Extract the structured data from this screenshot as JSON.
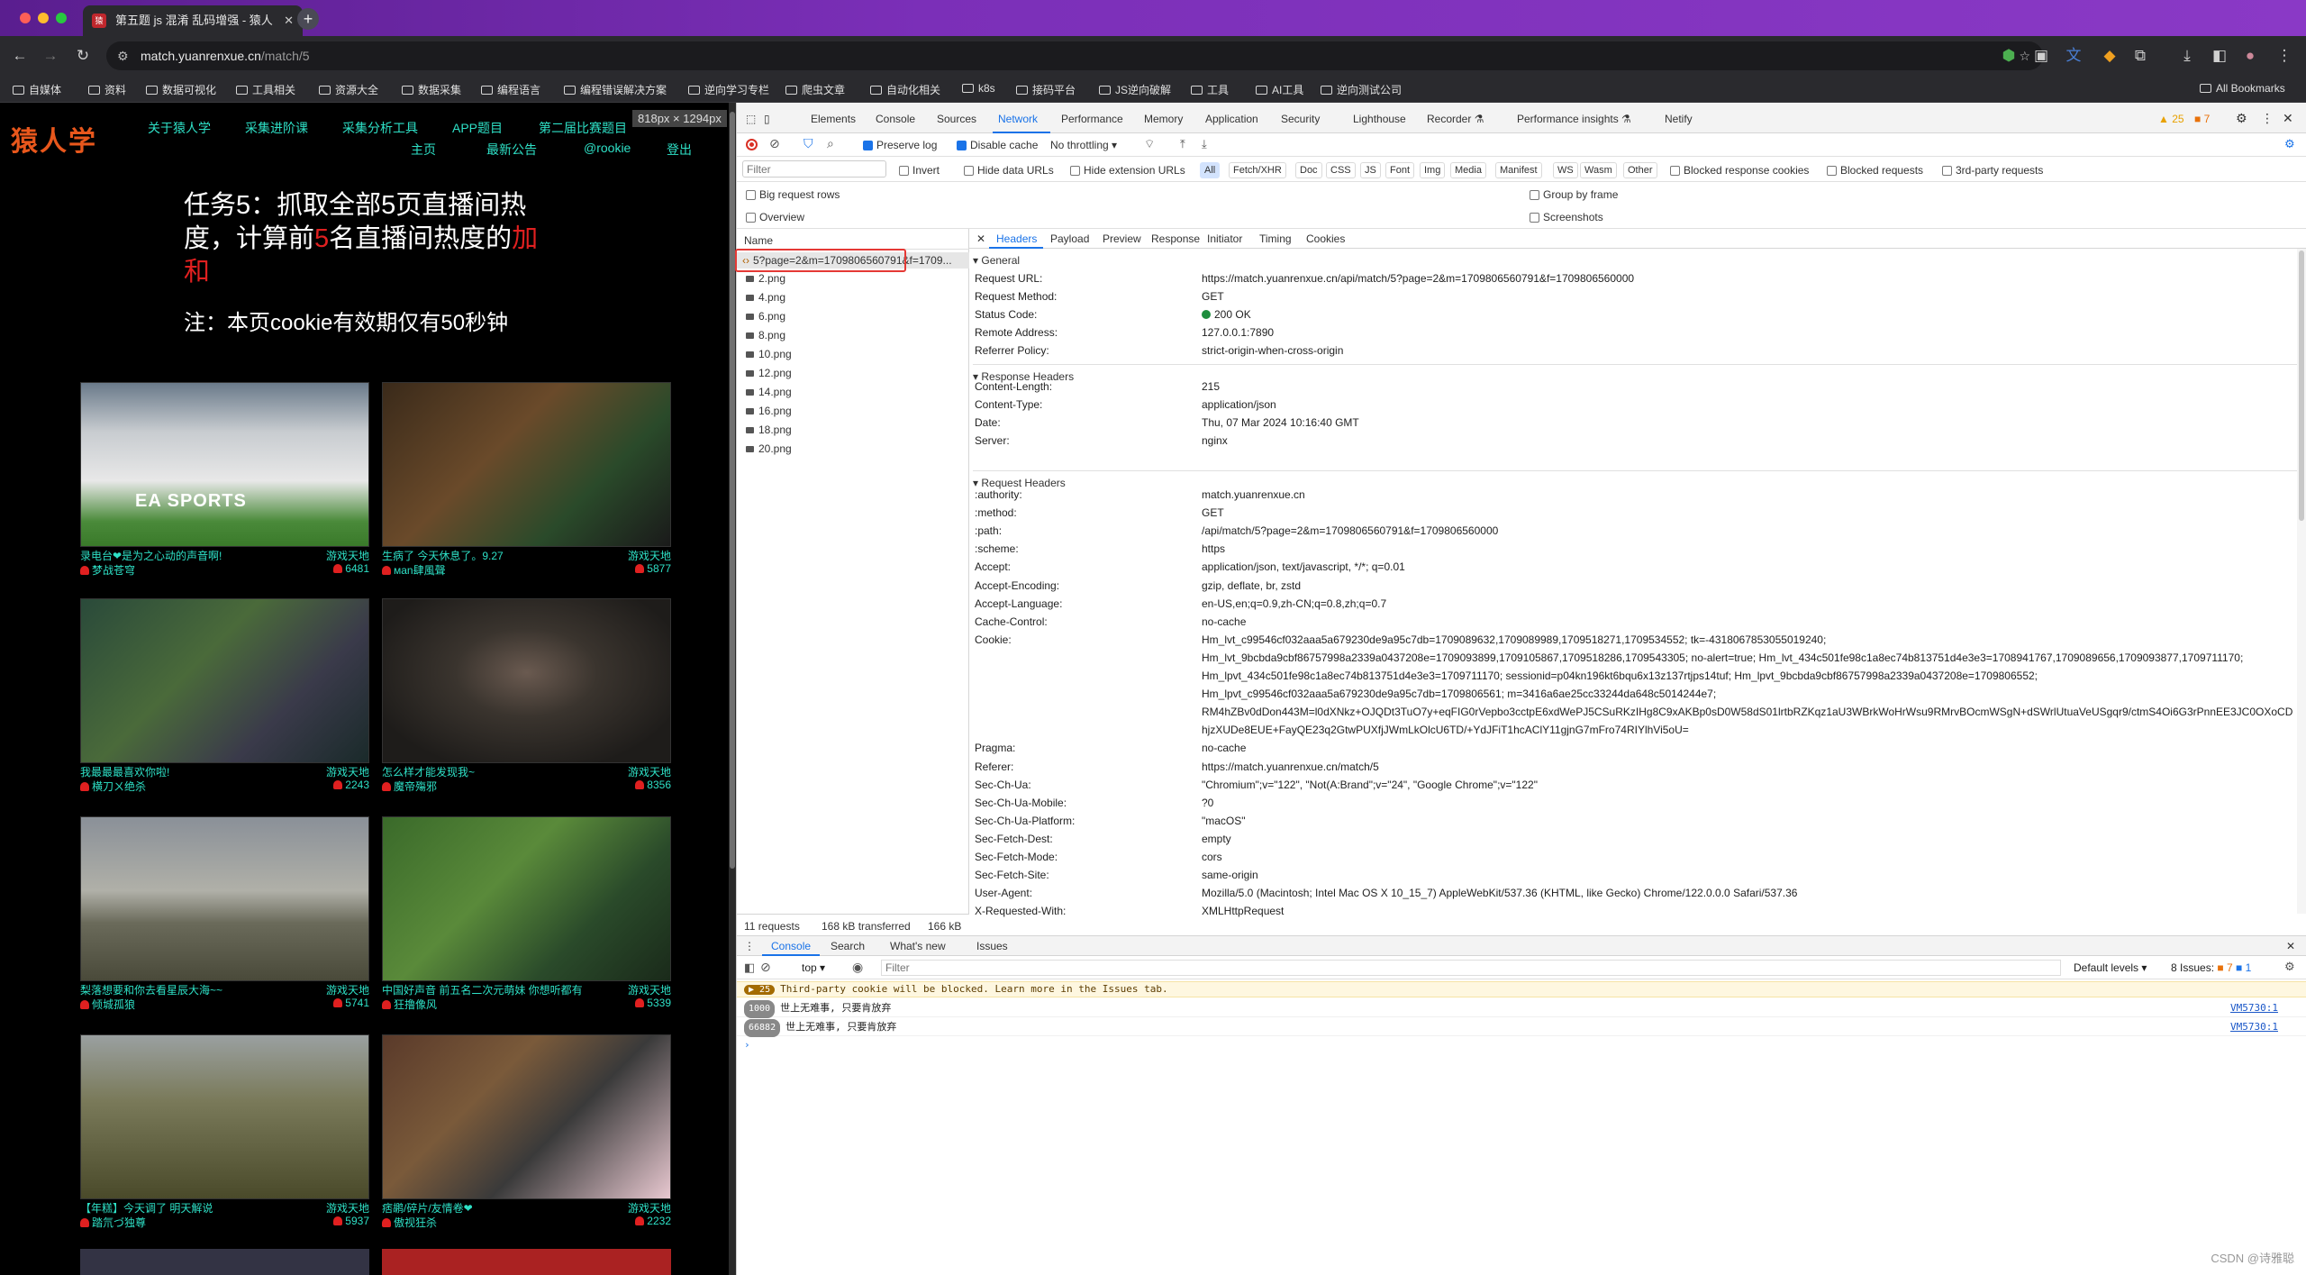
{
  "browser": {
    "tab_title": "第五题 js 混淆 乱码增强 - 猿人",
    "tab_favicon": "猿",
    "url_host": "match.yuanrenxue.cn",
    "url_path": "/match/5",
    "bookmarks": [
      "自媒体",
      "资料",
      "数据可视化",
      "工具相关",
      "资源大全",
      "数据采集",
      "编程语言",
      "编程错误解决方案",
      "逆向学习专栏",
      "爬虫文章",
      "自动化相关",
      "k8s",
      "接码平台",
      "JS逆向破解",
      "工具",
      "AI工具",
      "逆向测试公司"
    ],
    "all_bookmarks": "All Bookmarks"
  },
  "site": {
    "logo": "猿人学",
    "nav": [
      "关于猿人学",
      "采集进阶课",
      "采集分析工具",
      "APP题目",
      "第二届比赛题目",
      "主页",
      "最新公告",
      "@rookie",
      "登出"
    ],
    "dim_badge": "818px × 1294px",
    "task_prefix": "任务5：抓取全部5页直播间热度，计算前",
    "task_num": "5",
    "task_mid": "名直播间热度的",
    "task_red": "加和",
    "note": "注：本页cookie有效期仅有50秒钟",
    "cards": [
      {
        "title": "录电台❤是为之心动的声音啊!",
        "cat": "游戏天地",
        "author": "梦战苍穹",
        "hot": "6481"
      },
      {
        "title": "生病了 今天休息了。9.27",
        "cat": "游戏天地",
        "author": "мan肆風聲",
        "hot": "5877"
      },
      {
        "title": "我最最最喜欢你啦!",
        "cat": "游戏天地",
        "author": "横刀ㄨ绝杀",
        "hot": "2243"
      },
      {
        "title": "怎么样才能发现我~",
        "cat": "游戏天地",
        "author": "魔帝殤邪",
        "hot": "8356"
      },
      {
        "title": "梨落想要和你去看星辰大海~~",
        "cat": "游戏天地",
        "author": "倾城孤狼",
        "hot": "5741"
      },
      {
        "title": "中国好声音 前五名二次元萌妹 你想听都有",
        "cat": "游戏天地",
        "author": "狂撸像风",
        "hot": "5339"
      },
      {
        "title": "【年糕】今天调了 明天解说",
        "cat": "游戏天地",
        "author": "踏氘づ独尊",
        "hot": "5937"
      },
      {
        "title": "痞鹕/碎片/友情卷❤",
        "cat": "游戏天地",
        "author": "傲视狂杀",
        "hot": "2232"
      }
    ]
  },
  "devtools": {
    "tabs": [
      "Elements",
      "Console",
      "Sources",
      "Network",
      "Performance",
      "Memory",
      "Application",
      "Security",
      "Lighthouse",
      "Recorder ⚗",
      "Performance insights ⚗",
      "Netify"
    ],
    "warn_count": "25",
    "err_count": "7",
    "toolbar": {
      "preserve_log": "Preserve log",
      "disable_cache": "Disable cache",
      "throttling": "No throttling"
    },
    "filter_placeholder": "Filter",
    "filter_opts": [
      "Invert",
      "Hide data URLs",
      "Hide extension URLs"
    ],
    "chips": [
      "All",
      "Fetch/XHR",
      "Doc",
      "CSS",
      "JS",
      "Font",
      "Img",
      "Media",
      "Manifest",
      "WS",
      "Wasm",
      "Other"
    ],
    "extra_opts": [
      "Blocked response cookies",
      "Blocked requests",
      "3rd-party requests"
    ],
    "opts": [
      "Big request rows",
      "Overview",
      "Group by frame",
      "Screenshots"
    ],
    "name_header": "Name",
    "requests": [
      "5?page=2&m=1709806560791&f=1709...",
      "2.png",
      "4.png",
      "6.png",
      "8.png",
      "10.png",
      "12.png",
      "14.png",
      "16.png",
      "18.png",
      "20.png"
    ],
    "status": {
      "requests": "11 requests",
      "transferred": "168 kB transferred",
      "resources": "166 kB"
    },
    "detail_tabs": [
      "Headers",
      "Payload",
      "Preview",
      "Response",
      "Initiator",
      "Timing",
      "Cookies"
    ],
    "general_title": "General",
    "general": [
      [
        "Request URL:",
        "https://match.yuanrenxue.cn/api/match/5?page=2&m=1709806560791&f=1709806560000"
      ],
      [
        "Request Method:",
        "GET"
      ],
      [
        "Status Code:",
        "200 OK"
      ],
      [
        "Remote Address:",
        "127.0.0.1:7890"
      ],
      [
        "Referrer Policy:",
        "strict-origin-when-cross-origin"
      ]
    ],
    "response_title": "Response Headers",
    "response": [
      [
        "Content-Length:",
        "215"
      ],
      [
        "Content-Type:",
        "application/json"
      ],
      [
        "Date:",
        "Thu, 07 Mar 2024 10:16:40 GMT"
      ],
      [
        "Server:",
        "nginx"
      ]
    ],
    "request_title": "Request Headers",
    "request": [
      [
        ":authority:",
        "match.yuanrenxue.cn"
      ],
      [
        ":method:",
        "GET"
      ],
      [
        ":path:",
        "/api/match/5?page=2&m=1709806560791&f=1709806560000"
      ],
      [
        ":scheme:",
        "https"
      ],
      [
        "Accept:",
        "application/json, text/javascript, */*; q=0.01"
      ],
      [
        "Accept-Encoding:",
        "gzip, deflate, br, zstd"
      ],
      [
        "Accept-Language:",
        "en-US,en;q=0.9,zh-CN;q=0.8,zh;q=0.7"
      ],
      [
        "Cache-Control:",
        "no-cache"
      ],
      [
        "Cookie:",
        "Hm_lvt_c99546cf032aaa5a679230de9a95c7db=1709089632,1709089989,1709518271,1709534552; tk=-4318067853055019240;"
      ],
      [
        "",
        "Hm_lvt_9bcbda9cbf86757998a2339a0437208e=1709093899,1709105867,1709518286,1709543305; no-alert=true; Hm_lvt_434c501fe98c1a8ec74b813751d4e3e3=1708941767,1709089656,1709093877,1709711170;"
      ],
      [
        "",
        "Hm_lpvt_434c501fe98c1a8ec74b813751d4e3e3=1709711170; sessionid=p04kn196kt6bqu6x13z137rtjps14tuf; Hm_lpvt_9bcbda9cbf86757998a2339a0437208e=1709806552;"
      ],
      [
        "",
        "Hm_lpvt_c99546cf032aaa5a679230de9a95c7db=1709806561; m=3416a6ae25cc33244da648c5014244e7;"
      ],
      [
        "",
        "RM4hZBv0dDon443M=l0dXNkz+OJQDt3TuO7y+eqFIG0rVepbo3cctpE6xdWePJ5CSuRKzIHg8C9xAKBp0sD0W58dS01lrtbRZKqz1aU3WBrkWoHrWsu9RMrvBOcmWSgN+dSWrlUtuaVeUSgqr9/ctmS4Oi6G3rPnnEE3JC0OXoCD"
      ],
      [
        "",
        "hjzXUDe8EUE+FayQE23q2GtwPUXfjJWmLkOlcU6TD/+YdJFiT1hcAClY11gjnG7mFro74RIYlhVi5oU="
      ],
      [
        "Pragma:",
        "no-cache"
      ],
      [
        "Referer:",
        "https://match.yuanrenxue.cn/match/5"
      ],
      [
        "Sec-Ch-Ua:",
        "\"Chromium\";v=\"122\", \"Not(A:Brand\";v=\"24\", \"Google Chrome\";v=\"122\""
      ],
      [
        "Sec-Ch-Ua-Mobile:",
        "?0"
      ],
      [
        "Sec-Ch-Ua-Platform:",
        "\"macOS\""
      ],
      [
        "Sec-Fetch-Dest:",
        "empty"
      ],
      [
        "Sec-Fetch-Mode:",
        "cors"
      ],
      [
        "Sec-Fetch-Site:",
        "same-origin"
      ],
      [
        "User-Agent:",
        "Mozilla/5.0 (Macintosh; Intel Mac OS X 10_15_7) AppleWebKit/537.36 (KHTML, like Gecko) Chrome/122.0.0.0 Safari/537.36"
      ],
      [
        "X-Requested-With:",
        "XMLHttpRequest"
      ]
    ],
    "console": {
      "tabs": [
        "Console",
        "Search",
        "What's new",
        "Issues"
      ],
      "context": "top",
      "filter_placeholder": "Filter",
      "levels": "Default levels",
      "issues_label": "8 Issues:",
      "issues_err": "7",
      "issues_info": "1",
      "warning_count": "25",
      "warning": "Third-party cookie will be blocked. Learn more in the Issues tab.",
      "logs": [
        {
          "count": "1000",
          "text": "世上无难事, 只要肯放弃",
          "src": "VM5730:1"
        },
        {
          "count": "66882",
          "text": "世上无难事, 只要肯放弃",
          "src": "VM5730:1"
        }
      ]
    },
    "watermark": "CSDN @诗雅聪"
  }
}
